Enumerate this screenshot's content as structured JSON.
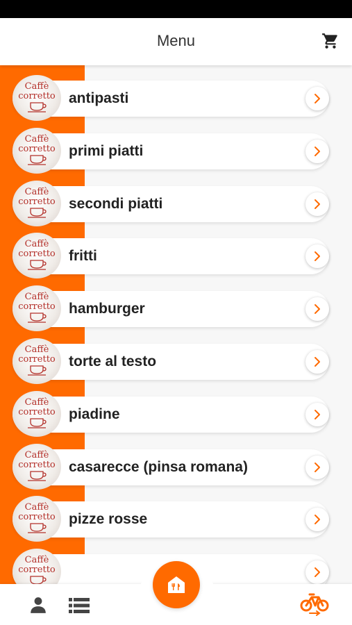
{
  "header": {
    "title": "Menu",
    "cart_icon": "cart-icon"
  },
  "menu": {
    "logo_text_top": "Caffè",
    "logo_text_bottom": "corretto",
    "items": [
      {
        "label": "antipasti"
      },
      {
        "label": "primi piatti"
      },
      {
        "label": "secondi piatti"
      },
      {
        "label": "fritti"
      },
      {
        "label": "hamburger"
      },
      {
        "label": "torte al testo"
      },
      {
        "label": "piadine"
      },
      {
        "label": "casarecce (pinsa romana)"
      },
      {
        "label": "pizze rosse"
      },
      {
        "label": ""
      }
    ]
  },
  "bottom_nav": {
    "items": [
      {
        "icon": "person-icon"
      },
      {
        "icon": "list-icon"
      },
      {
        "icon": "restaurant-home-icon"
      },
      {
        "icon": "bicycle-delivery-icon"
      }
    ]
  },
  "colors": {
    "accent": "#ff6a00",
    "logo_red": "#b3302a"
  }
}
